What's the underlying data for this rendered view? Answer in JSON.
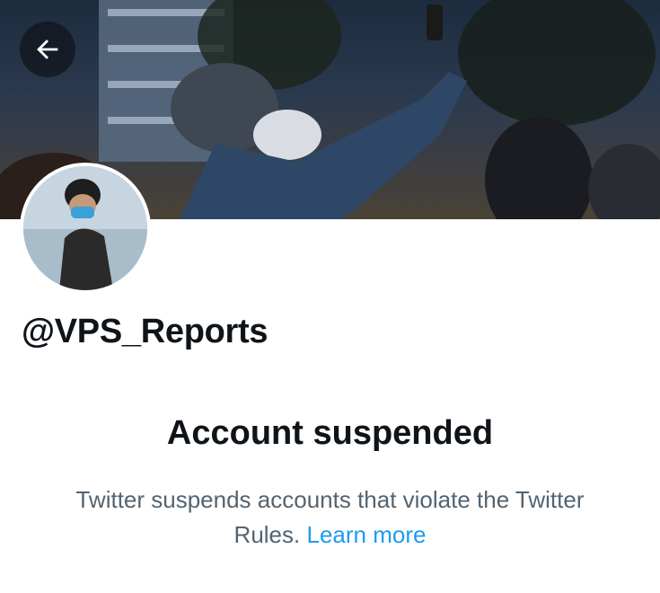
{
  "profile": {
    "handle": "@VPS_Reports"
  },
  "notice": {
    "title": "Account suspended",
    "description": "Twitter suspends accounts that violate the Twitter Rules.",
    "link_label": "Learn more"
  },
  "icons": {
    "back": "arrow-left-icon"
  },
  "colors": {
    "text_primary": "#0f1419",
    "text_secondary": "#536471",
    "link": "#1d9bf0",
    "back_button_bg": "#0f1419"
  }
}
